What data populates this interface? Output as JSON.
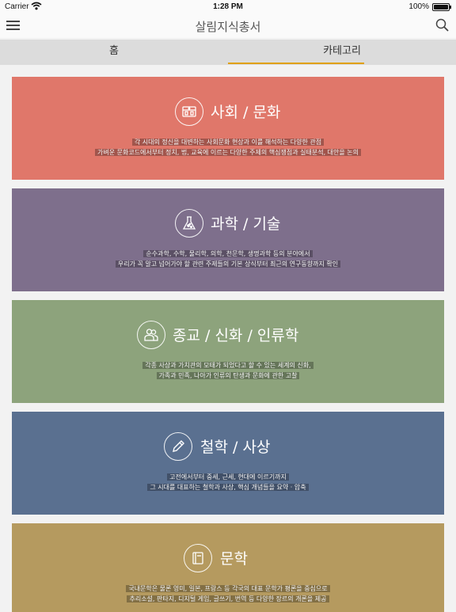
{
  "status_bar": {
    "carrier": "Carrier",
    "time": "1:28 PM",
    "battery": "100%"
  },
  "nav": {
    "title": "살림지식총서",
    "menu_icon": "hamburger-menu-icon",
    "search_icon": "search-icon"
  },
  "tabs": [
    {
      "label": "홈",
      "selected": false
    },
    {
      "label": "카테고리",
      "selected": true
    }
  ],
  "accent_color": "#e0a000",
  "categories": [
    {
      "title": "사회 / 문화",
      "icon": "culture-building-icon",
      "color": "#e0776a",
      "desc_line1": "각 시대의 정신을 대변하는 사회문화 현상과 이를 해석하는 다양한 관점",
      "desc_line2": "가벼운 문화코드에서부터 정치, 법, 교육에 이르는 다양한 주제의 핵심쟁점과 실태분석, 대안을 논의"
    },
    {
      "title": "과학 / 기술",
      "icon": "flask-icon",
      "color": "#7e6f8c",
      "desc_line1": "순수과학, 수학, 물리학, 의학, 천문학, 생명과학 등의 분야에서",
      "desc_line2": "우리가 꼭 알고 넘어가야 할 관련 주제들의 기본 상식부터 최근의 연구동향까지 확인"
    },
    {
      "title": "종교 / 신화 / 인류학",
      "icon": "people-icon",
      "color": "#8da37c",
      "desc_line1": "각종 사상과 가치관의 모태가 되었다고 할 수 있는 세계의 신화,",
      "desc_line2": "가족과 민족, 나아가 인류의 탄생과 문화에 관한 고찰"
    },
    {
      "title": "철학 / 사상",
      "icon": "pencil-icon",
      "color": "#5a7090",
      "desc_line1": "고전에서부터 중세, 근세, 현대에 이르기까지",
      "desc_line2": "그 시대를 대표하는 철학과 사상, 핵심 개념들을 요약 · 압축"
    },
    {
      "title": "문학",
      "icon": "book-icon",
      "color": "#b59a5f",
      "desc_line1": "국내문학은 물론 영미, 일본, 프랑스 등 각국의 대표 문학가 평론을 중심으로",
      "desc_line2": "추리소설, 판타지, 디지털 게임, 글쓰기, 번역 등 다양한 장르의 개론을 제공"
    }
  ]
}
